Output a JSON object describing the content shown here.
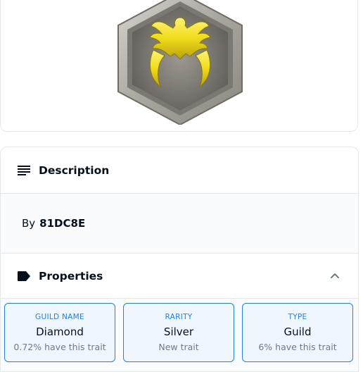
{
  "description": {
    "title": "Description",
    "by_label": "By",
    "creator": "81DC8E"
  },
  "properties": {
    "title": "Properties",
    "traits": [
      {
        "type": "GUILD NAME",
        "value": "Diamond",
        "rarity": "0.72% have this trait"
      },
      {
        "type": "RARITY",
        "value": "Silver",
        "rarity": "New trait"
      },
      {
        "type": "TYPE",
        "value": "Guild",
        "rarity": "6% have this trait"
      }
    ]
  },
  "icons": {
    "description": "list-lines-icon",
    "properties": "label-tag-icon",
    "collapse": "chevron-up-icon"
  },
  "colors": {
    "accent": "#2081e2",
    "emblem_gold": "#f3e21c",
    "frame_stone": "#b9b6ae"
  }
}
